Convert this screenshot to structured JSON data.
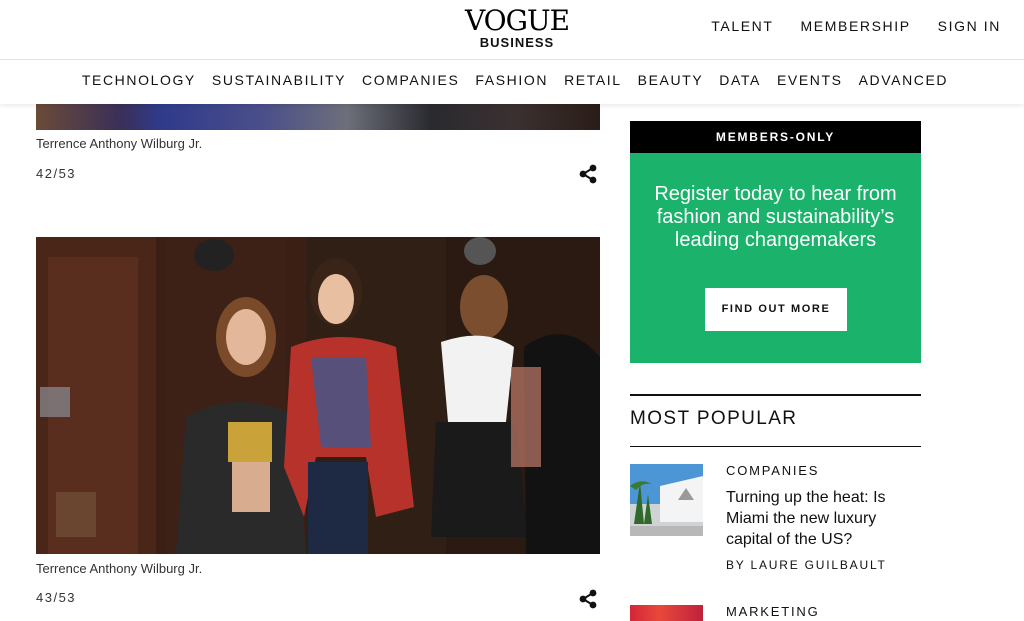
{
  "header": {
    "logo_main": "VOGUE",
    "logo_sub": "BUSINESS",
    "top_links": [
      "TALENT",
      "MEMBERSHIP",
      "SIGN IN"
    ]
  },
  "categories": [
    "TECHNOLOGY",
    "SUSTAINABILITY",
    "COMPANIES",
    "FASHION",
    "RETAIL",
    "BEAUTY",
    "DATA",
    "EVENTS",
    "ADVANCED"
  ],
  "gallery": {
    "items": [
      {
        "caption": "Terrence Anthony Wilburg Jr.",
        "counter": "42/53"
      },
      {
        "caption": "Terrence Anthony Wilburg Jr.",
        "counter": "43/53"
      }
    ]
  },
  "ad": {
    "header": "MEMBERS-ONLY",
    "line1": "Register today to hear from",
    "line2": "fashion and sustainability’s",
    "line3": "leading changemakers",
    "button": "FIND OUT MORE",
    "colors": {
      "bg": "#1bb26b",
      "header_bg": "#000000"
    }
  },
  "most_popular": {
    "title": "MOST POPULAR",
    "items": [
      {
        "category": "COMPANIES",
        "headline": "Turning up the heat: Is Miami the new luxury capital of the US?",
        "byline": "BY LAURE GUILBAULT"
      },
      {
        "category": "MARKETING"
      }
    ]
  },
  "icons": [
    "share-icon"
  ]
}
